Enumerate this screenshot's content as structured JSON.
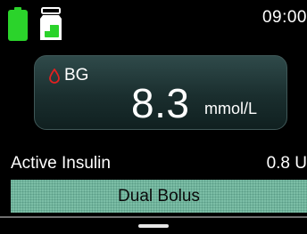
{
  "status_bar": {
    "time": "09:00",
    "battery_icon": "battery-icon",
    "reservoir_icon": "insulin-reservoir-icon",
    "battery_color": "#2bd32b"
  },
  "bg_card": {
    "label": "BG",
    "value": "8.3",
    "unit": "mmol/L",
    "icon": "blood-drop-icon",
    "icon_color": "#e32020"
  },
  "active_insulin": {
    "label": "Active Insulin",
    "value": "0.8 U"
  },
  "bolus_status": {
    "label": "Dual Bolus",
    "color": "#7cbea6"
  }
}
